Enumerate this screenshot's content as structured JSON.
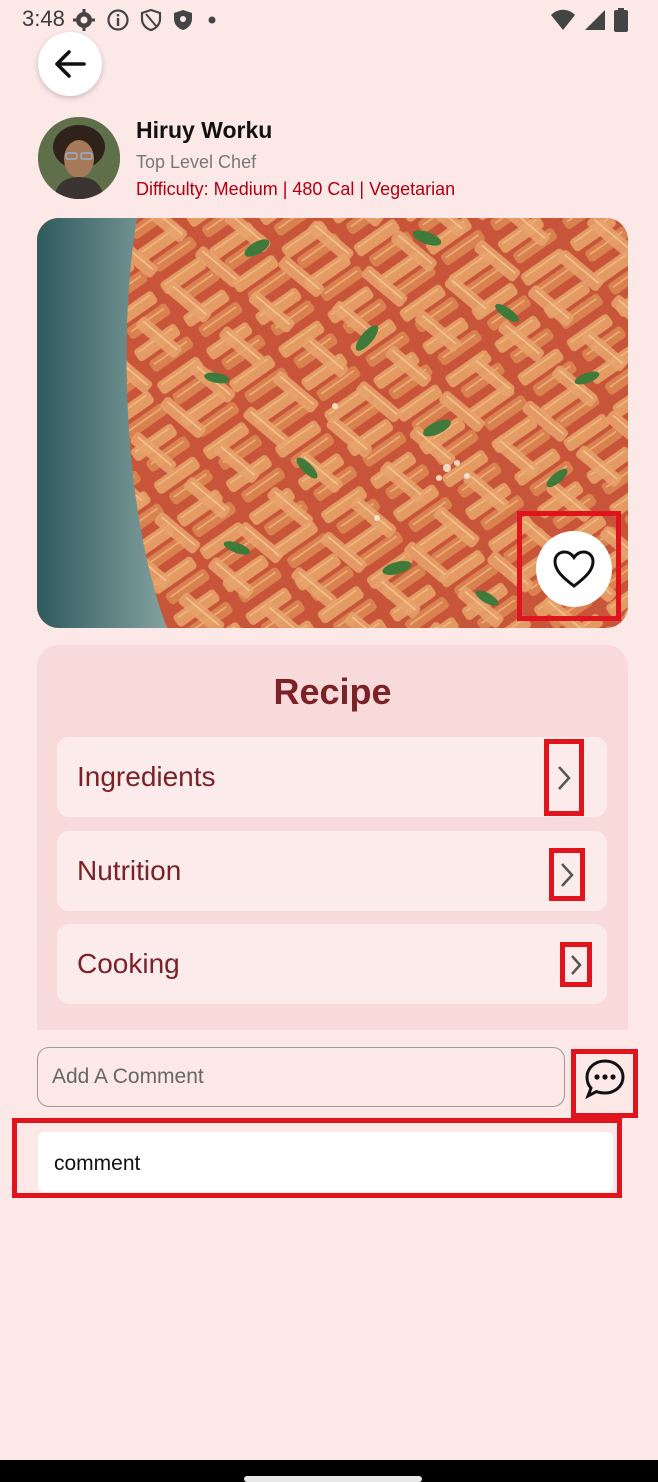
{
  "status_bar": {
    "time": "3:48",
    "left_icons": [
      "settings-icon",
      "info-icon",
      "shield-icon",
      "shield-filled-icon",
      "dot-icon"
    ],
    "right_icons": [
      "wifi-icon",
      "signal-icon",
      "battery-icon"
    ]
  },
  "chef": {
    "name": "Hiruy Worku",
    "title": "Top Level Chef"
  },
  "recipe_meta": "Difficulty: Medium | 480 Cal | Vegetarian",
  "recipe": {
    "title": "Recipe",
    "sections": [
      {
        "label": "Ingredients"
      },
      {
        "label": "Nutrition"
      },
      {
        "label": "Cooking"
      }
    ]
  },
  "comment_form": {
    "placeholder": "Add A Comment"
  },
  "comments": [
    {
      "text": "comment"
    }
  ],
  "colors": {
    "background": "#fde8e8",
    "accent": "#7a2228",
    "meta_text": "#b00012",
    "highlight": "#e0141c"
  }
}
